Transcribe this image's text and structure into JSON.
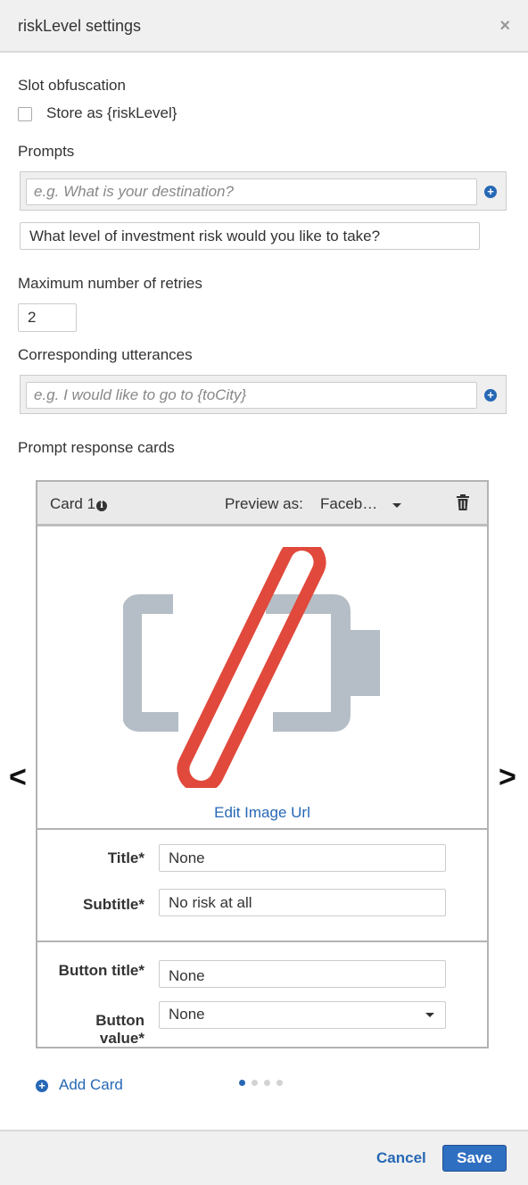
{
  "header": {
    "title": "riskLevel settings",
    "close_icon": "×"
  },
  "slot_obfuscation": {
    "label": "Slot obfuscation",
    "checkbox_label": "Store as {riskLevel}",
    "checked": false
  },
  "prompts": {
    "label": "Prompts",
    "placeholder": "e.g. What is your destination?",
    "items": [
      "What level of investment risk would you like to take?"
    ]
  },
  "retries": {
    "label": "Maximum number of retries",
    "value": "2"
  },
  "utterances": {
    "label": "Corresponding utterances",
    "placeholder": "e.g. I would like to go to {toCity}"
  },
  "response_cards": {
    "label": "Prompt response cards",
    "card": {
      "title": "Card 1",
      "info_icon": "i",
      "preview_label": "Preview as:",
      "preview_value": "Faceb…",
      "edit_image_link": "Edit Image Url",
      "title_label": "Title*",
      "title_value": "None",
      "subtitle_label": "Subtitle*",
      "subtitle_value": "No risk at all",
      "button_title_label": "Button title*",
      "button_title_value": "None",
      "button_value_label_line1": "Button",
      "button_value_label_line2": "value*",
      "button_value_selected": "None"
    },
    "prev_arrow": "<",
    "next_arrow": ">",
    "add_card_label": "Add Card",
    "add_card_icon": "+",
    "pages": 4,
    "active_page": 1
  },
  "footer": {
    "cancel_label": "Cancel",
    "save_label": "Save"
  },
  "colors": {
    "accent": "#2668b5",
    "broken_image_red": "#e0493b",
    "broken_image_gray": "#b5bec6"
  }
}
